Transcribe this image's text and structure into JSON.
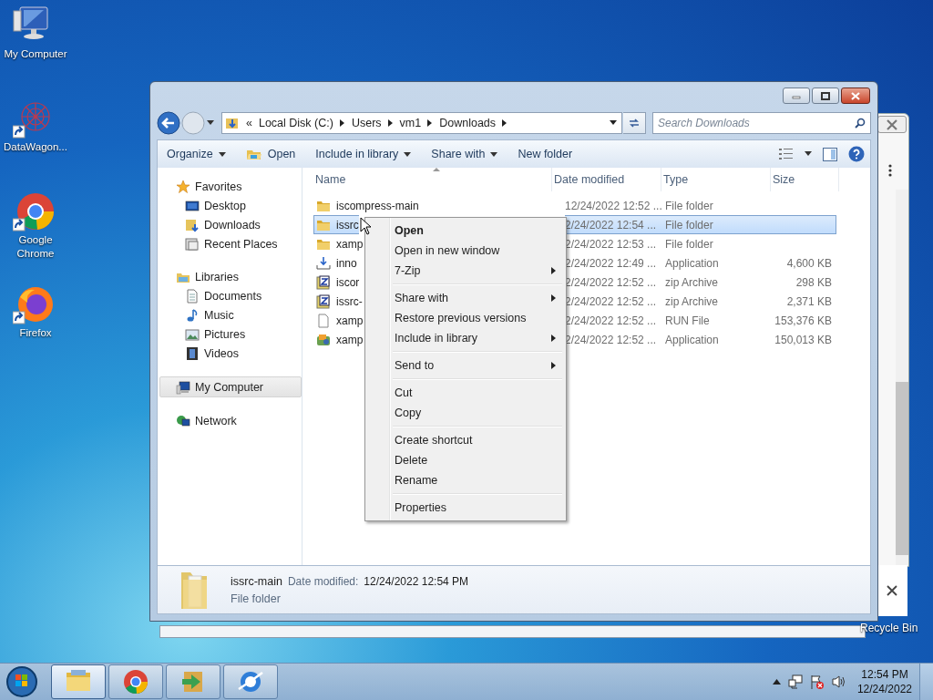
{
  "desktop_icons": [
    {
      "label": "My Computer",
      "kind": "computer",
      "shortcut": false
    },
    {
      "label": "DataWagon...",
      "kind": "network-ball",
      "shortcut": true
    },
    {
      "label": "Google Chrome",
      "kind": "chrome",
      "shortcut": true
    },
    {
      "label": "Firefox",
      "kind": "firefox",
      "shortcut": true
    }
  ],
  "recycle_bin_label": "Recycle Bin",
  "explorer": {
    "address": {
      "overflow_mark": "«",
      "crumbs": [
        "Local Disk (C:)",
        "Users",
        "vm1",
        "Downloads"
      ]
    },
    "search": {
      "placeholder": "Search Downloads"
    },
    "toolbar": [
      {
        "label": "Organize",
        "kind": "plain",
        "dropdown": true
      },
      {
        "label": "Open",
        "kind": "open",
        "dropdown": false
      },
      {
        "label": "Include in library",
        "kind": "plain",
        "dropdown": true
      },
      {
        "label": "Share with",
        "kind": "plain",
        "dropdown": true
      },
      {
        "label": "New folder",
        "kind": "plain",
        "dropdown": false
      }
    ],
    "navigation": [
      {
        "label": "Favorites",
        "kind": "star",
        "selected": false,
        "children": [
          {
            "label": "Desktop",
            "kind": "desktop",
            "selected": false
          },
          {
            "label": "Downloads",
            "kind": "downloads",
            "selected": false
          },
          {
            "label": "Recent Places",
            "kind": "recent",
            "selected": false
          }
        ]
      },
      {
        "label": "Libraries",
        "kind": "library",
        "selected": false,
        "children": [
          {
            "label": "Documents",
            "kind": "document",
            "selected": false
          },
          {
            "label": "Music",
            "kind": "music",
            "selected": false
          },
          {
            "label": "Pictures",
            "kind": "picture",
            "selected": false
          },
          {
            "label": "Videos",
            "kind": "video",
            "selected": false
          }
        ]
      },
      {
        "label": "My Computer",
        "kind": "computer",
        "selected": true
      },
      {
        "label": "Network",
        "kind": "network",
        "selected": false
      }
    ],
    "columns": [
      {
        "label": "Name",
        "sorted": true
      },
      {
        "label": "Date modified",
        "sorted": false
      },
      {
        "label": "Type",
        "sorted": false
      },
      {
        "label": "Size",
        "sorted": false
      }
    ],
    "files": [
      {
        "name": "iscompress-main",
        "kind": "folder",
        "date": "12/24/2022 12:52 ...",
        "type": "File folder",
        "selected": false
      },
      {
        "name": "issrc",
        "kind": "folder",
        "date": "2/24/2022 12:54 ...",
        "type": "File folder",
        "selected": true
      },
      {
        "name": "xamp",
        "kind": "folder",
        "date": "2/24/2022 12:53 ...",
        "type": "File folder",
        "selected": false
      },
      {
        "name": "inno",
        "kind": "installer",
        "date": "2/24/2022 12:49 ...",
        "type": "Application",
        "size": "4,600 KB",
        "selected": false
      },
      {
        "name": "iscor",
        "kind": "zip",
        "date": "2/24/2022 12:52 ...",
        "type": "zip Archive",
        "size": "298 KB",
        "selected": false
      },
      {
        "name": "issrc-",
        "kind": "zip",
        "date": "2/24/2022 12:52 ...",
        "type": "zip Archive",
        "size": "2,371 KB",
        "selected": false
      },
      {
        "name": "xamp",
        "kind": "file",
        "date": "2/24/2022 12:52 ...",
        "type": "RUN File",
        "size": "153,376 KB",
        "selected": false
      },
      {
        "name": "xamp",
        "kind": "app",
        "date": "2/24/2022 12:52 ...",
        "type": "Application",
        "size": "150,013 KB",
        "selected": false
      }
    ],
    "details": {
      "name": "issrc-main",
      "date_label": "Date modified:",
      "date": "12/24/2022 12:54 PM",
      "type": "File folder"
    }
  },
  "context_menu": {
    "groups": [
      [
        {
          "label": "Open",
          "default": true,
          "submenu": false
        },
        {
          "label": "Open in new window",
          "default": false,
          "submenu": false
        },
        {
          "label": "7-Zip",
          "default": false,
          "submenu": true
        }
      ],
      [
        {
          "label": "Share with",
          "default": false,
          "submenu": true
        },
        {
          "label": "Restore previous versions",
          "default": false,
          "submenu": false
        },
        {
          "label": "Include in library",
          "default": false,
          "submenu": true
        }
      ],
      [
        {
          "label": "Send to",
          "default": false,
          "submenu": true
        }
      ],
      [
        {
          "label": "Cut",
          "default": false,
          "submenu": false
        },
        {
          "label": "Copy",
          "default": false,
          "submenu": false
        }
      ],
      [
        {
          "label": "Create shortcut",
          "default": false,
          "submenu": false
        },
        {
          "label": "Delete",
          "default": false,
          "submenu": false
        },
        {
          "label": "Rename",
          "default": false,
          "submenu": false
        }
      ],
      [
        {
          "label": "Properties",
          "default": false,
          "submenu": false
        }
      ]
    ]
  },
  "taskbar": {
    "apps": [
      {
        "kind": "explorer",
        "active": true
      },
      {
        "kind": "chrome",
        "active": false
      },
      {
        "kind": "arrow-app",
        "active": false
      },
      {
        "kind": "ie",
        "active": false
      }
    ],
    "clock": {
      "time": "12:54 PM",
      "date": "12/24/2022"
    }
  }
}
